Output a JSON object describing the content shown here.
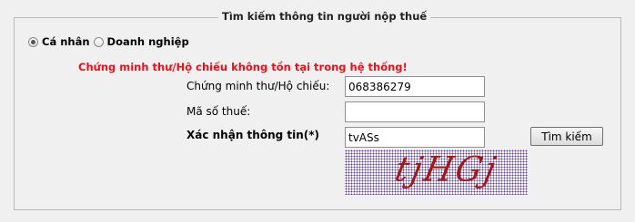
{
  "legend": "Tìm kiếm thông tin người nộp thuế",
  "taxpayer_type": {
    "options": [
      {
        "label": "Cá nhân",
        "checked": true
      },
      {
        "label": "Doanh nghiệp",
        "checked": false
      }
    ]
  },
  "error_message": "Chứng minh thư/Hộ chiếu không tồn tại trong hệ thống!",
  "form": {
    "id_label": "Chứng minh thư/Hộ chiếu:",
    "id_value": "068386279",
    "tax_code_label": "Mã số thuế:",
    "tax_code_value": "",
    "captcha_label": "Xác nhận thông tin(*)",
    "captcha_value": "tvASs",
    "search_button": "Tìm kiếm",
    "captcha_image_text": "tjHGj"
  },
  "colors": {
    "error": "#e8101a",
    "captcha_text": "#a01818",
    "captcha_noise": "#5a3b9a"
  }
}
